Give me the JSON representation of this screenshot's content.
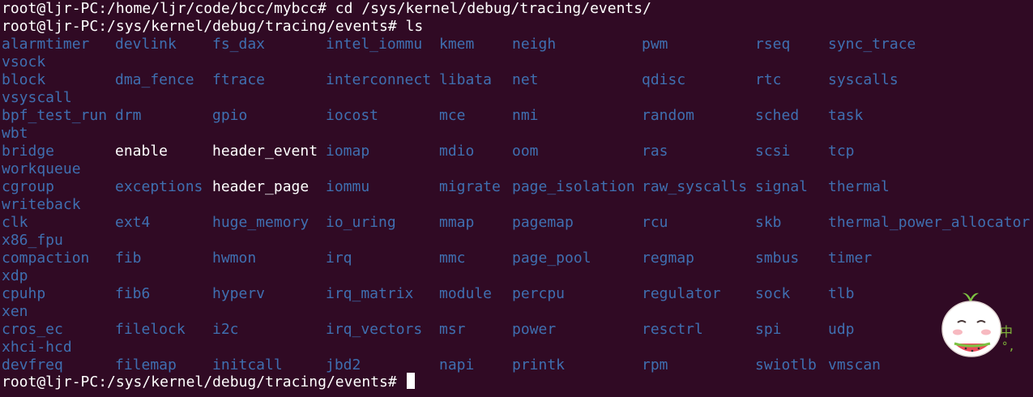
{
  "prompt_cmd": "root@ljr-PC:/home/ljr/code/bcc/mybcc# cd /sys/kernel/debug/tracing/events/",
  "prompt_ls": "root@ljr-PC:/sys/kernel/debug/tracing/events# ls",
  "prompt_final": "root@ljr-PC:/sys/kernel/debug/tracing/events# ",
  "colors": {
    "background": "#300a24",
    "directory": "#3f6fb0",
    "text": "#ffffff"
  },
  "rows": [
    {
      "cells": [
        "alarmtimer",
        "devlink",
        "fs_dax",
        "intel_iommu",
        "kmem",
        "neigh",
        "pwm",
        "rseq",
        "sync_trace"
      ],
      "wrap": "vsock"
    },
    {
      "cells": [
        "block",
        "dma_fence",
        "ftrace",
        "interconnect",
        "libata",
        "net",
        "qdisc",
        "rtc",
        "syscalls"
      ],
      "wrap": "vsyscall"
    },
    {
      "cells": [
        "bpf_test_run",
        "drm",
        "gpio",
        "iocost",
        "mce",
        "nmi",
        "random",
        "sched",
        "task"
      ],
      "wrap": "wbt"
    },
    {
      "cells": [
        "bridge",
        "enable",
        "header_event",
        "iomap",
        "mdio",
        "oom",
        "ras",
        "scsi",
        "tcp"
      ],
      "wrap": "workqueue"
    },
    {
      "cells": [
        "cgroup",
        "exceptions",
        "header_page",
        "iommu",
        "migrate",
        "page_isolation",
        "raw_syscalls",
        "signal",
        "thermal"
      ],
      "wrap": "writeback"
    },
    {
      "cells": [
        "clk",
        "ext4",
        "huge_memory",
        "io_uring",
        "mmap",
        "pagemap",
        "rcu",
        "skb",
        "thermal_power_allocator"
      ],
      "wrap": "x86_fpu"
    },
    {
      "cells": [
        "compaction",
        "fib",
        "hwmon",
        "irq",
        "mmc",
        "page_pool",
        "regmap",
        "smbus",
        "timer"
      ],
      "wrap": "xdp"
    },
    {
      "cells": [
        "cpuhp",
        "fib6",
        "hyperv",
        "irq_matrix",
        "module",
        "percpu",
        "regulator",
        "sock",
        "tlb"
      ],
      "wrap": "xen"
    },
    {
      "cells": [
        "cros_ec",
        "filelock",
        "i2c",
        "irq_vectors",
        "msr",
        "power",
        "resctrl",
        "spi",
        "udp"
      ],
      "wrap": "xhci-hcd"
    },
    {
      "cells": [
        "devfreq",
        "filemap",
        "initcall",
        "jbd2",
        "napi",
        "printk",
        "rpm",
        "swiotlb",
        "vmscan"
      ],
      "wrap": ""
    }
  ],
  "plain_files": [
    "enable",
    "header_event",
    "header_page"
  ],
  "ime": {
    "char": "中",
    "dots": "°,"
  }
}
